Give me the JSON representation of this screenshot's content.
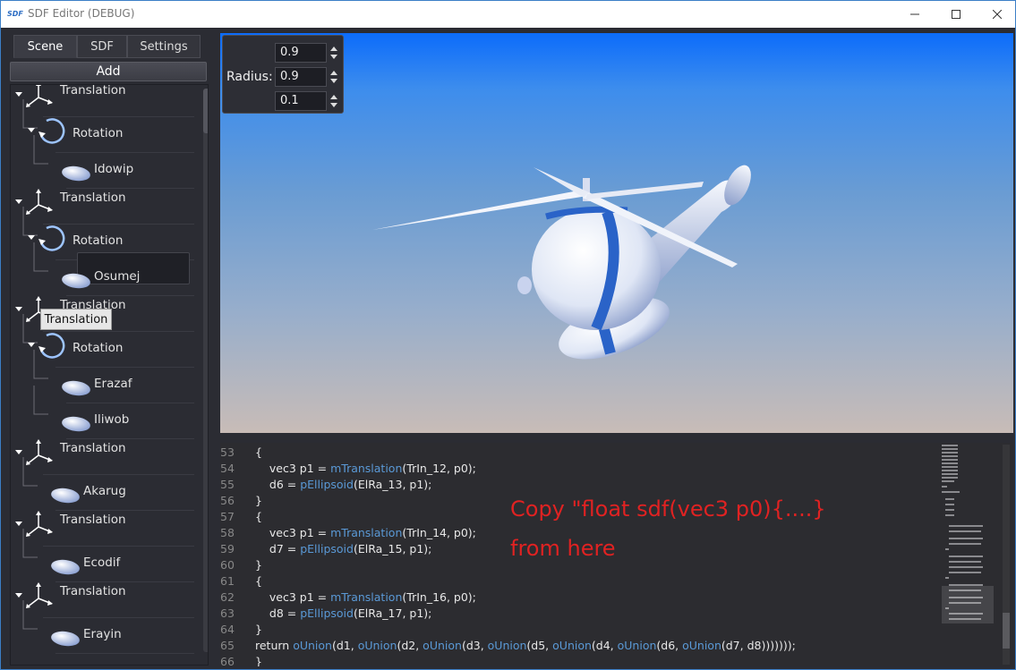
{
  "window": {
    "icon_text": "SDF",
    "title": "SDF Editor (DEBUG)"
  },
  "tabs": [
    "Scene",
    "SDF",
    "Settings"
  ],
  "active_tab": "Scene",
  "add_button": "Add",
  "tree": [
    {
      "type": "translation",
      "label": "Translation",
      "indent": 0
    },
    {
      "type": "rotation",
      "label": "Rotation",
      "indent": 1
    },
    {
      "type": "ellipsoid",
      "label": "Idowip",
      "indent": 2
    },
    {
      "type": "translation",
      "label": "Translation",
      "indent": 0
    },
    {
      "type": "rotation",
      "label": "Rotation",
      "indent": 1
    },
    {
      "type": "ellipsoid",
      "label": "Osumej",
      "indent": 2,
      "selected": true
    },
    {
      "type": "translation",
      "label": "Translation",
      "indent": 0
    },
    {
      "type": "rotation",
      "label": "Rotation",
      "indent": 1
    },
    {
      "type": "ellipsoid",
      "label": "Erazaf",
      "indent": 2
    },
    {
      "type": "ellipsoid",
      "label": "Iliwob",
      "indent": 2
    },
    {
      "type": "translation",
      "label": "Translation",
      "indent": 0
    },
    {
      "type": "ellipsoid",
      "label": "Akarug",
      "indent": 1
    },
    {
      "type": "translation",
      "label": "Translation",
      "indent": 0
    },
    {
      "type": "ellipsoid",
      "label": "Ecodif",
      "indent": 1
    },
    {
      "type": "translation",
      "label": "Translation",
      "indent": 0
    },
    {
      "type": "ellipsoid",
      "label": "Erayin",
      "indent": 1
    }
  ],
  "tooltip": "Translation",
  "radius": {
    "label": "Radius:",
    "values": [
      "0.9",
      "0.9",
      "0.1"
    ]
  },
  "code_lines": [
    {
      "n": "53",
      "segs": [
        [
          "",
          "{"
        ]
      ]
    },
    {
      "n": "54",
      "segs": [
        [
          "",
          "    vec3 p1 = "
        ],
        [
          "fn",
          "mTranslation"
        ],
        [
          "",
          "(TrIn_12, p0);"
        ]
      ]
    },
    {
      "n": "55",
      "segs": [
        [
          "",
          "    d6 = "
        ],
        [
          "fn",
          "pEllipsoid"
        ],
        [
          "",
          "(ElRa_13, p1);"
        ]
      ]
    },
    {
      "n": "56",
      "segs": [
        [
          "",
          "}"
        ]
      ]
    },
    {
      "n": "57",
      "segs": [
        [
          "",
          "{"
        ]
      ]
    },
    {
      "n": "58",
      "segs": [
        [
          "",
          "    vec3 p1 = "
        ],
        [
          "fn",
          "mTranslation"
        ],
        [
          "",
          "(TrIn_14, p0);"
        ]
      ]
    },
    {
      "n": "59",
      "segs": [
        [
          "",
          "    d7 = "
        ],
        [
          "fn",
          "pEllipsoid"
        ],
        [
          "",
          "(ElRa_15, p1);"
        ]
      ]
    },
    {
      "n": "60",
      "segs": [
        [
          "",
          "}"
        ]
      ]
    },
    {
      "n": "61",
      "segs": [
        [
          "",
          "{"
        ]
      ]
    },
    {
      "n": "62",
      "segs": [
        [
          "",
          "    vec3 p1 = "
        ],
        [
          "fn",
          "mTranslation"
        ],
        [
          "",
          "(TrIn_16, p0);"
        ]
      ]
    },
    {
      "n": "63",
      "segs": [
        [
          "",
          "    d8 = "
        ],
        [
          "fn",
          "pEllipsoid"
        ],
        [
          "",
          "(ElRa_17, p1);"
        ]
      ]
    },
    {
      "n": "64",
      "segs": [
        [
          "",
          "}"
        ]
      ]
    },
    {
      "n": "65",
      "segs": [
        [
          "",
          "return "
        ],
        [
          "fn",
          "oUnion"
        ],
        [
          "",
          "(d1, "
        ],
        [
          "fn",
          "oUnion"
        ],
        [
          "",
          "(d2, "
        ],
        [
          "fn",
          "oUnion"
        ],
        [
          "",
          "(d3, "
        ],
        [
          "fn",
          "oUnion"
        ],
        [
          "",
          "(d5, "
        ],
        [
          "fn",
          "oUnion"
        ],
        [
          "",
          "(d4, "
        ],
        [
          "fn",
          "oUnion"
        ],
        [
          "",
          "(d6, "
        ],
        [
          "fn",
          "oUnion"
        ],
        [
          "",
          "(d7, d8)))))));"
        ]
      ]
    },
    {
      "n": "66",
      "segs": [
        [
          "",
          "}"
        ]
      ]
    }
  ],
  "annotation": {
    "line1": "Copy \"float sdf(vec3 p0){....}",
    "line2": "from here"
  },
  "colors": {
    "accent": "#3c7fc7",
    "code_function": "#5a99d6",
    "annotation": "#e02222",
    "sky_top": "#0c6cfb",
    "sky_bottom": "#c8bcb7",
    "helicopter_body": "#e8ecf6",
    "helicopter_stripe": "#2a63c8"
  }
}
